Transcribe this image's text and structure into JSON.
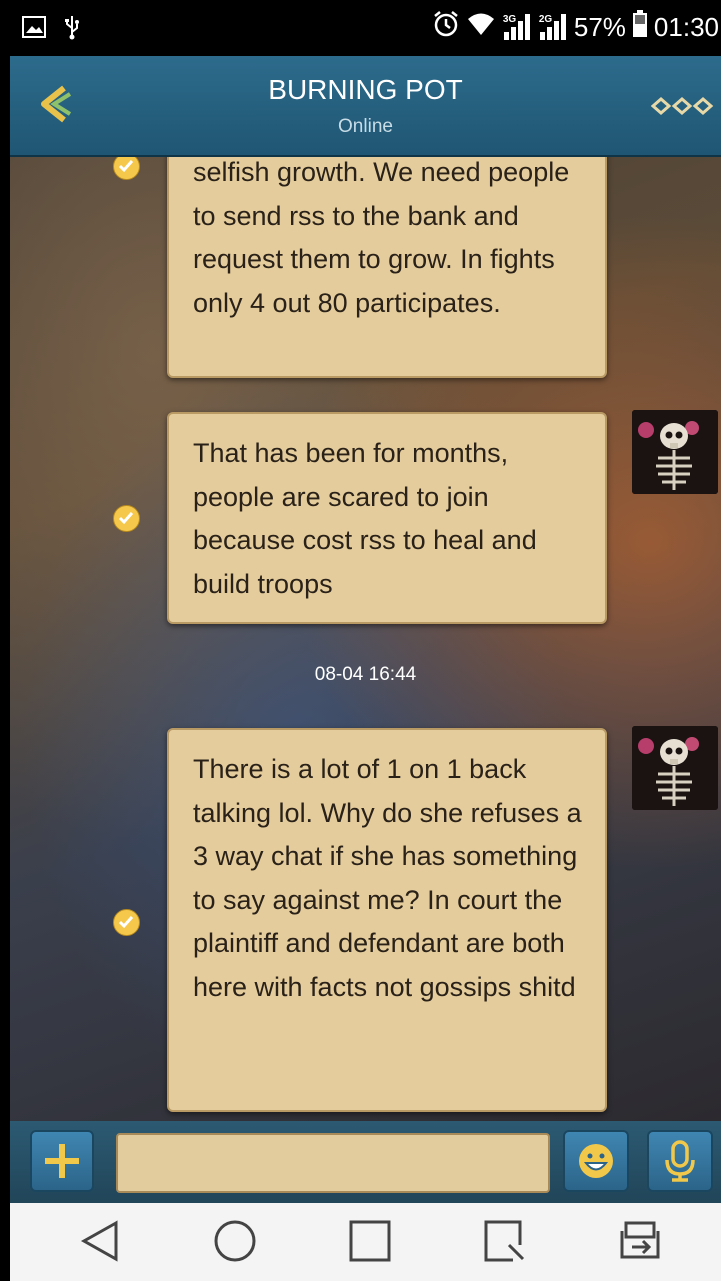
{
  "status_bar": {
    "signal1_label": "3G",
    "signal2_label": "2G",
    "battery": "57%",
    "time": "01:30"
  },
  "header": {
    "title": "BURNING POT",
    "status": "Online"
  },
  "messages": [
    {
      "text": "selfish growth. We need people to send rss to the bank and request them to grow. In fights only 4 out 80 participates."
    },
    {
      "text": "That has been for months, people are scared to join because cost rss to heal and build troops"
    },
    {
      "text": "There is a lot of 1 on 1 back talking lol. Why do she refuses a 3 way chat if she has something to say against me? In court the plaintiff and defendant are both here with facts not gossips shitd"
    }
  ],
  "timestamp": "08-04 16:44",
  "input": {
    "value": ""
  },
  "colors": {
    "bubble": "#e4cc9c",
    "header": "#2d6b8c",
    "check": "#f5c84c"
  }
}
